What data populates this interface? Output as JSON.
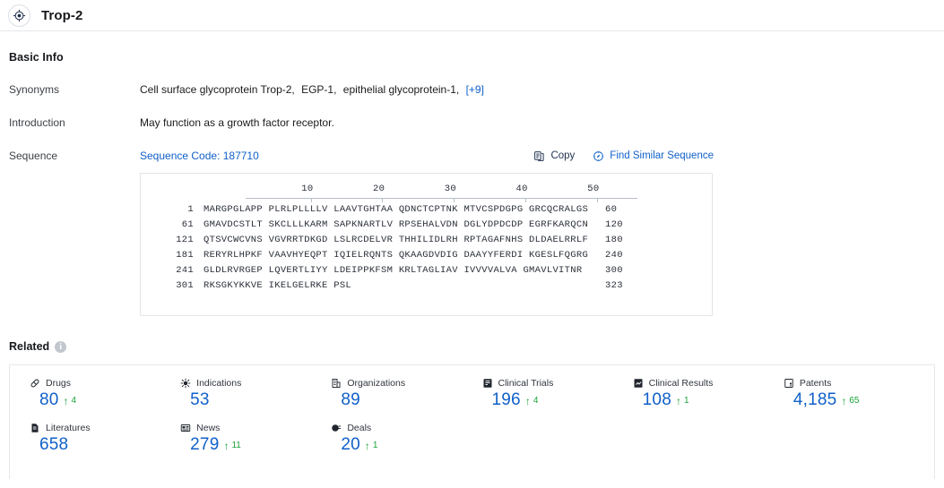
{
  "header": {
    "icon": "target-icon",
    "title": "Trop-2"
  },
  "basic_info": {
    "title": "Basic Info",
    "rows": {
      "synonyms": {
        "label": "Synonyms",
        "values": [
          "Cell surface glycoprotein Trop-2,",
          "EGP-1,",
          "epithelial glycoprotein-1,"
        ],
        "more": "[+9]"
      },
      "introduction": {
        "label": "Introduction",
        "value": "May function as a growth factor receptor."
      },
      "sequence": {
        "label": "Sequence",
        "code_label": "Sequence Code: 187710",
        "copy_label": "Copy",
        "find_similar_label": "Find Similar Sequence"
      }
    }
  },
  "sequence_view": {
    "ruler_ticks": [
      10,
      20,
      30,
      40,
      50
    ],
    "lines": [
      {
        "start": "1",
        "chunks": "MARGPGLAPP PLRLPLLLLV LAAVTGHTAA QDNCTCPTNK MTVCSPDGPG GRCQCRALGS",
        "end": "60"
      },
      {
        "start": "61",
        "chunks": "GMAVDCSTLT SKCLLLKARM SAPKNARTLV RPSEHALVDN DGLYDPDCDP EGRFKARQCN",
        "end": "120"
      },
      {
        "start": "121",
        "chunks": "QTSVCWCVNS VGVRRTDKGD LSLRCDELVR THHILIDLRH RPTAGAFNHS DLDAELRRLF",
        "end": "180"
      },
      {
        "start": "181",
        "chunks": "RERYRLHPKF VAAVHYEQPT IQIELRQNTS QKAAGDVDIG DAAYYFERDI KGESLFQGRG",
        "end": "240"
      },
      {
        "start": "241",
        "chunks": "GLDLRVRGEP LQVERTLIYY LDEIPPKFSM KRLTAGLIAV IVVVVALVA GMAVLVITNR",
        "end": "300"
      },
      {
        "start": "301",
        "chunks": "RKSGKYKKVE IKELGELRKE PSL",
        "end": "323"
      }
    ]
  },
  "related": {
    "title": "Related",
    "info_badge": "i",
    "stats": [
      {
        "icon": "pill-icon",
        "label": "Drugs",
        "value": "80",
        "delta": "4"
      },
      {
        "icon": "virus-icon",
        "label": "Indications",
        "value": "53",
        "delta": ""
      },
      {
        "icon": "organization-icon",
        "label": "Organizations",
        "value": "89",
        "delta": ""
      },
      {
        "icon": "clinical-trial-icon",
        "label": "Clinical Trials",
        "value": "196",
        "delta": "4"
      },
      {
        "icon": "clinical-result-icon",
        "label": "Clinical Results",
        "value": "108",
        "delta": "1"
      },
      {
        "icon": "patent-icon",
        "label": "Patents",
        "value": "4,185",
        "delta": "65"
      },
      {
        "icon": "literature-icon",
        "label": "Literatures",
        "value": "658",
        "delta": ""
      },
      {
        "icon": "news-icon",
        "label": "News",
        "value": "279",
        "delta": "11"
      },
      {
        "icon": "deal-icon",
        "label": "Deals",
        "value": "20",
        "delta": "1"
      }
    ]
  },
  "colors": {
    "link": "#1060c9",
    "up_arrow": "#19a33a",
    "text": "#1b1b1b",
    "border": "#e4e6eb"
  }
}
